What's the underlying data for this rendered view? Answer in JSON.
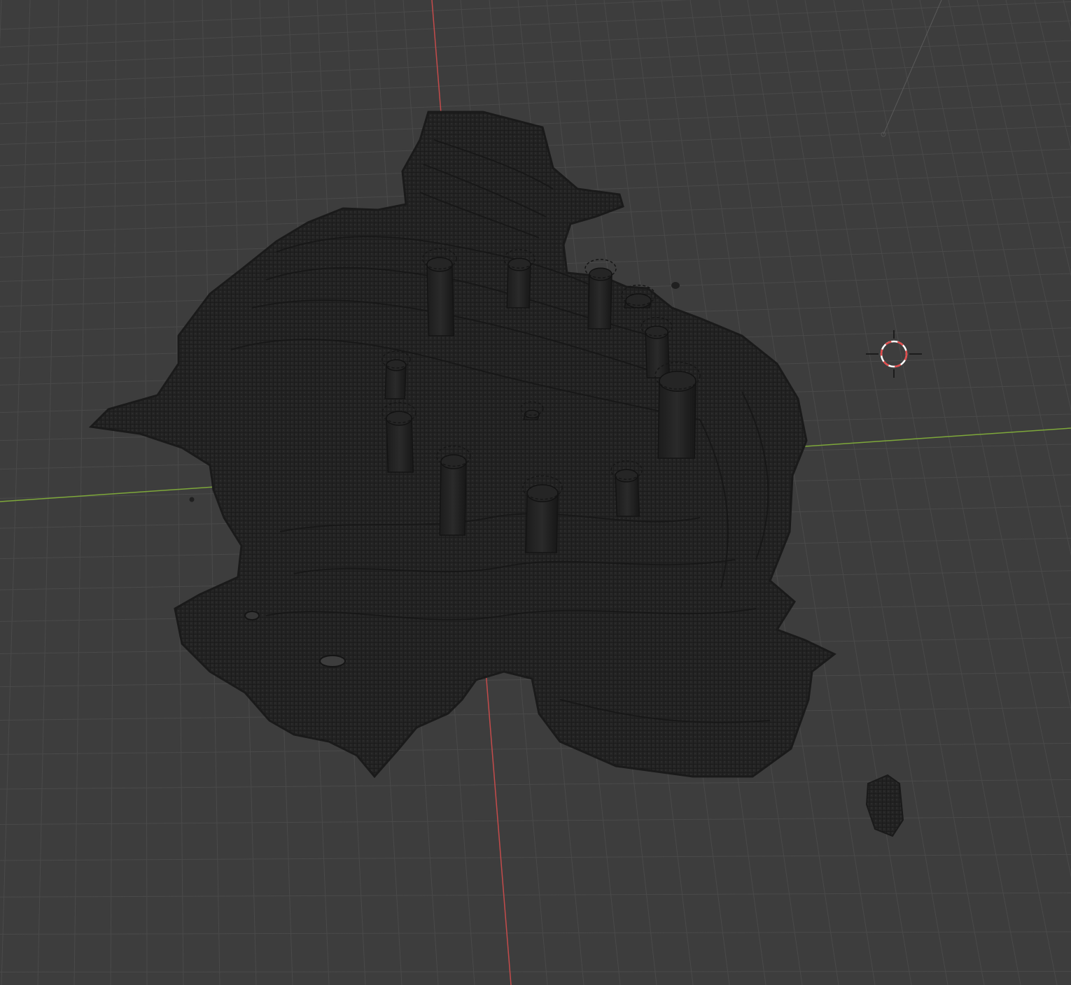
{
  "viewport": {
    "view": "perspective",
    "background_color": "#3d3d3d",
    "grid_line_color": "#4a4a4a",
    "x_axis_color": "#c44b4b",
    "y_axis_color": "#7ea83a",
    "mesh_color": "#232323",
    "mesh_wire_color": "#181818",
    "cursor_ring_colors": [
      "#e04a4a",
      "#ffffff"
    ]
  },
  "scene": {
    "objects": [
      {
        "name": "terrain-mesh",
        "type": "voxel mesh"
      },
      {
        "name": "pillar",
        "count": 12
      },
      {
        "name": "small-fragment"
      }
    ],
    "icons": [
      "3d-cursor-icon",
      "light-icon"
    ]
  }
}
